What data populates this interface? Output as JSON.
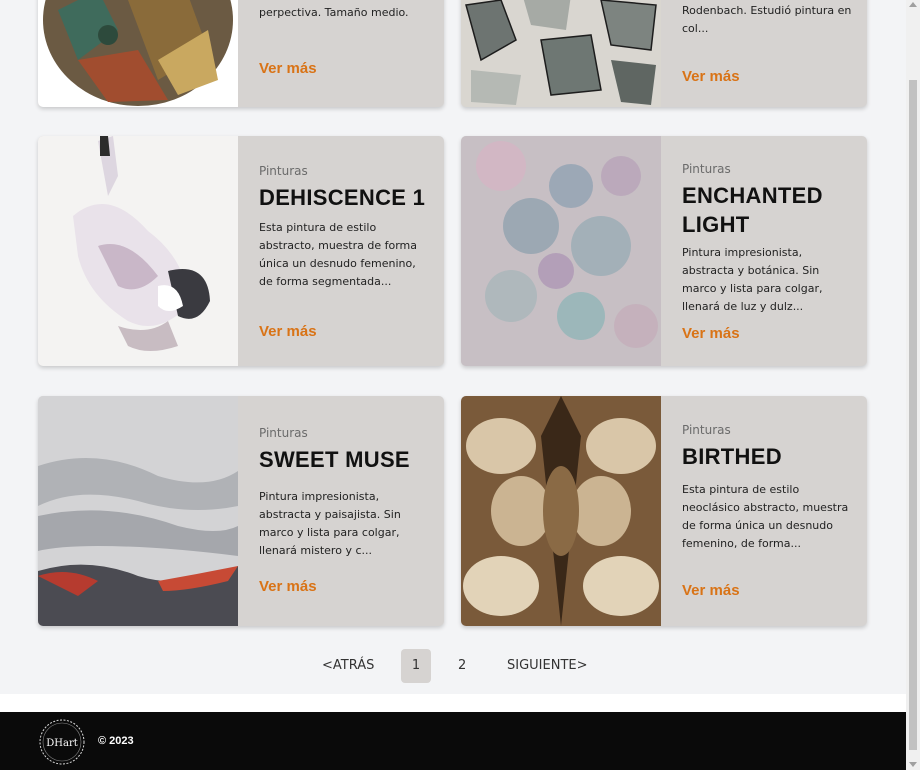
{
  "cards": [
    {
      "category": "",
      "title": "",
      "description": "perpectiva. Tamaño medio.",
      "more_label": "Ver más"
    },
    {
      "category": "",
      "title": "",
      "description": "Frankfurt y, vive y trabaja en Rodenbach. Estudió pintura en col...",
      "more_label": "Ver más"
    },
    {
      "category": "Pinturas",
      "title": "DEHISCENCE 1",
      "description": "Esta pintura de estilo abstracto, muestra de forma única un desnudo femenino, de forma segmentada...",
      "more_label": "Ver más"
    },
    {
      "category": "Pinturas",
      "title": "ENCHANTED LIGHT",
      "description": "Pintura impresionista, abstracta y botánica. Sin marco y lista para colgar, llenará de luz y dulz...",
      "more_label": "Ver más"
    },
    {
      "category": "Pinturas",
      "title": "SWEET MUSE",
      "description": "Pintura impresionista, abstracta y paisajista. Sin marco y lista para colgar, llenará mistero y c...",
      "more_label": "Ver más"
    },
    {
      "category": "Pinturas",
      "title": "BIRTHED",
      "description": "Esta pintura de estilo neoclásico abstracto, muestra de forma única un desnudo femenino, de forma...",
      "more_label": "Ver más"
    }
  ],
  "pagination": {
    "prev_label": "<ATRÁS",
    "pages": [
      "1",
      "2"
    ],
    "current": "1",
    "next_label": "SIGUIENTE>"
  },
  "footer": {
    "logo_text": "DHart",
    "copyright": "© 2023"
  },
  "colors": {
    "accent": "#d97316",
    "card_bg": "#d6d3d1",
    "footer_bg": "#0a0a0a"
  }
}
